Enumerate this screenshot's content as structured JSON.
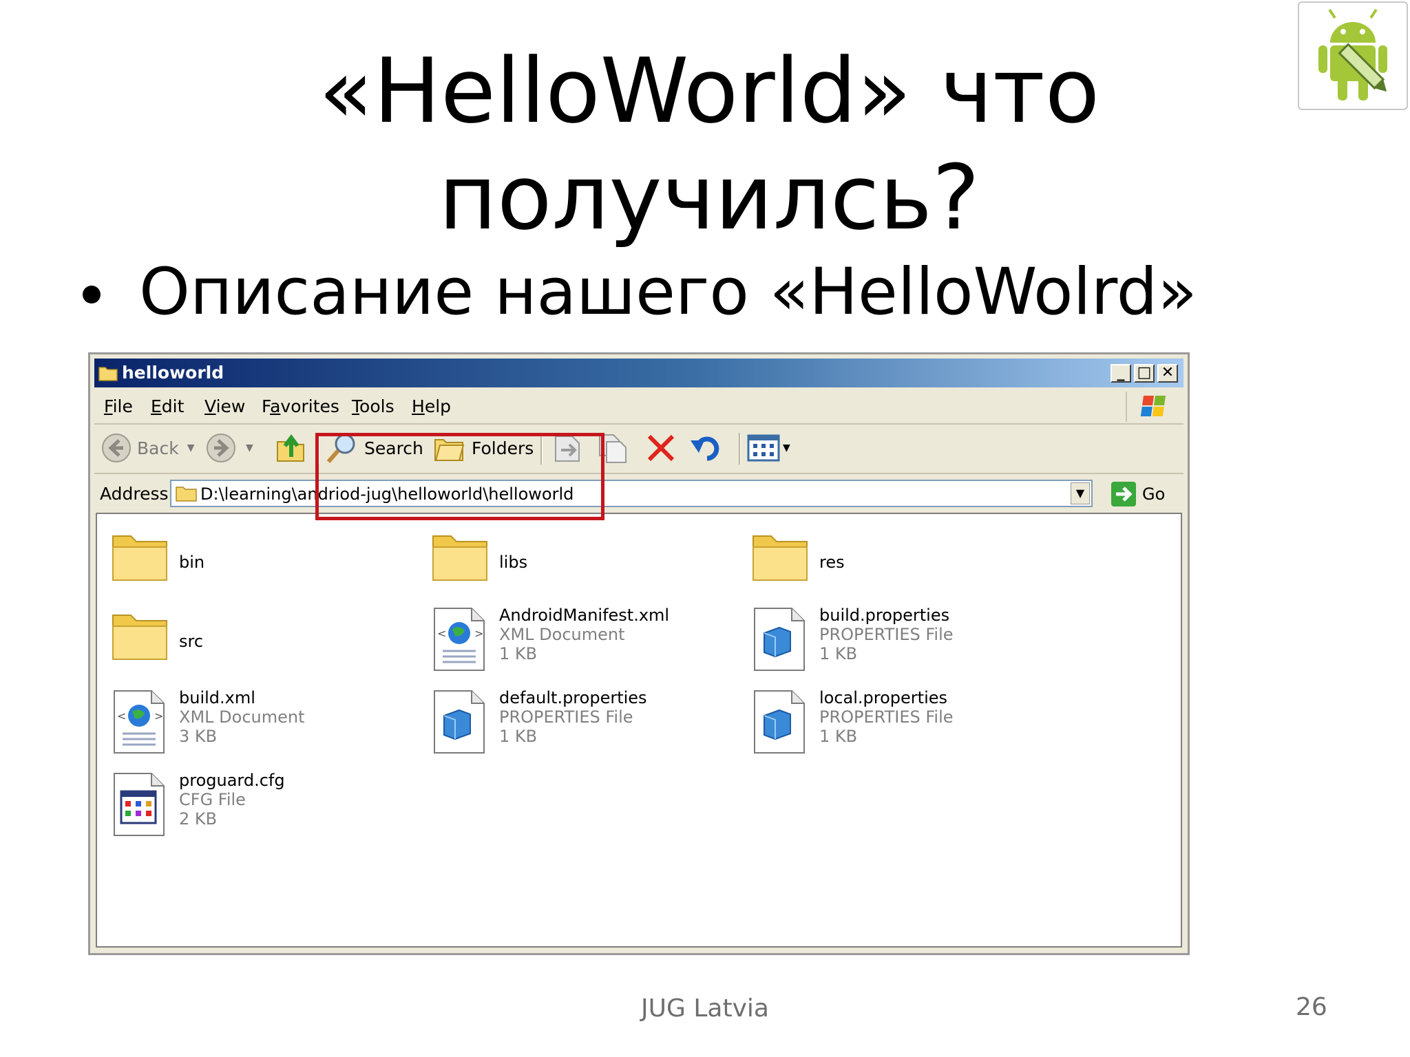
{
  "slide": {
    "title_line1": "«HelloWorld» что",
    "title_line2": "получилсь?",
    "bullet": "Описание нашего «HelloWolrd»",
    "footer": "JUG Latvia",
    "page_number": "26"
  },
  "window": {
    "title": "helloworld",
    "controls": {
      "minimize": "_",
      "maximize": "□",
      "close": "✕"
    },
    "menu": [
      {
        "key": "F",
        "rest": "ile"
      },
      {
        "key": "E",
        "rest": "dit"
      },
      {
        "key": "V",
        "rest": "iew"
      },
      {
        "key": "a",
        "pre": "F",
        "rest": "vorites"
      },
      {
        "key": "T",
        "rest": "ools"
      },
      {
        "key": "H",
        "rest": "elp"
      }
    ],
    "toolbar": {
      "back": "Back",
      "search": "Search",
      "folders": "Folders"
    },
    "address": {
      "label": "Address",
      "value": "D:\\learning\\andriod-jug\\helloworld\\helloworld",
      "go": "Go"
    },
    "items": [
      {
        "name": "bin",
        "type": "folder"
      },
      {
        "name": "libs",
        "type": "folder"
      },
      {
        "name": "res",
        "type": "folder"
      },
      {
        "name": "src",
        "type": "folder"
      },
      {
        "name": "AndroidManifest.xml",
        "type": "xml",
        "kind": "XML Document",
        "size": "1 KB"
      },
      {
        "name": "build.properties",
        "type": "properties",
        "kind": "PROPERTIES File",
        "size": "1 KB"
      },
      {
        "name": "build.xml",
        "type": "xml",
        "kind": "XML Document",
        "size": "3 KB"
      },
      {
        "name": "default.properties",
        "type": "properties",
        "kind": "PROPERTIES File",
        "size": "1 KB"
      },
      {
        "name": "local.properties",
        "type": "properties",
        "kind": "PROPERTIES File",
        "size": "1 KB"
      },
      {
        "name": "proguard.cfg",
        "type": "cfg",
        "kind": "CFG File",
        "size": "2 KB"
      }
    ]
  },
  "colors": {
    "highlight": "#c4161c",
    "titlebar_start": "#0a246a",
    "android_green": "#a4c639"
  }
}
